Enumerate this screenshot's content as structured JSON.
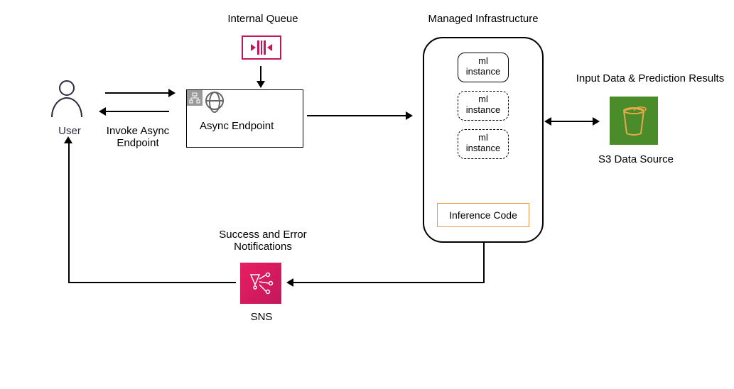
{
  "user": {
    "label": "User"
  },
  "invoke_label": "Invoke Async\nEndpoint",
  "queue": {
    "label": "Internal Queue"
  },
  "endpoint": {
    "label": "Async Endpoint"
  },
  "infra": {
    "label": "Managed Infrastructure",
    "instances": [
      "ml\ninstance",
      "ml\ninstance",
      "ml\ninstance"
    ],
    "inference": "Inference Code"
  },
  "s3": {
    "top_label": "Input Data & Prediction Results",
    "bottom_label": "S3 Data Source"
  },
  "sns": {
    "top_label": "Success and Error\nNotifications",
    "bottom_label": "SNS"
  }
}
